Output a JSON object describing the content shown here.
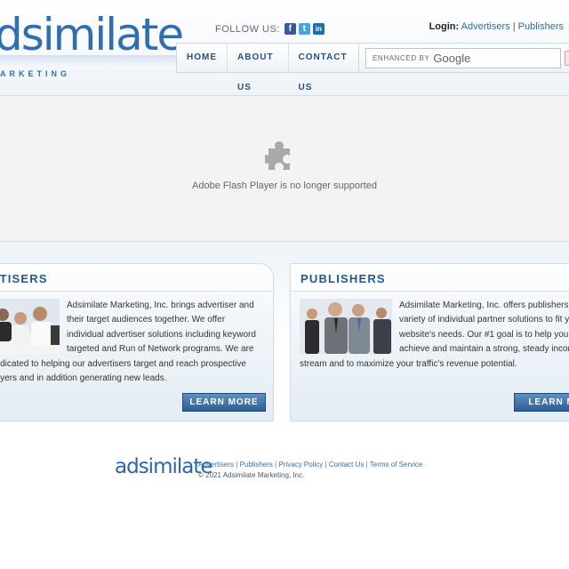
{
  "header": {
    "logo_text": "dsimilate",
    "logo_sub": "ARKETING",
    "follow_label": "FOLLOW US:",
    "social": {
      "facebook": "f",
      "twitter": "t",
      "linkedin": "in"
    },
    "login_label": "Login:",
    "login_advertisers": "Advertisers",
    "login_sep": "|",
    "login_publishers": "Publishers"
  },
  "nav": {
    "items": [
      "HOME",
      "ABOUT US",
      "CONTACT US"
    ]
  },
  "search": {
    "label": "ENHANCED BY",
    "brand": "Google"
  },
  "flash": {
    "message": "Adobe Flash Player is no longer supported"
  },
  "advertisers": {
    "title": "RTISERS",
    "text": "Adsimilate Marketing, Inc. brings advertiser and their target audiences together. We offer individual advertiser solutions including keyword targeted and Run of Network programs. We are dedicated to helping our advertisers target and reach prospective buyers and in addition generating new leads.",
    "button": "LEARN MORE"
  },
  "publishers": {
    "title": "PUBLISHERS",
    "text": "Adsimilate Marketing, Inc. offers publishers a variety of individual partner solutions to fit your website's needs. Our #1 goal is to help you achieve and maintain a strong, steady income stream and to maximize your traffic's revenue potential.",
    "button": "LEARN MO"
  },
  "footer": {
    "logo": "adsimilate",
    "links": [
      "Advertisers",
      "Publishers",
      "Privacy Policy",
      "Contact Us",
      "Terms of Service"
    ],
    "sep": "|",
    "copyright": "© 2021 Adsimilate Marketing, Inc."
  },
  "colors": {
    "brand_blue": "#2f6fb0",
    "button_blue": "#2c5f95",
    "link_blue": "#2a6db3"
  }
}
